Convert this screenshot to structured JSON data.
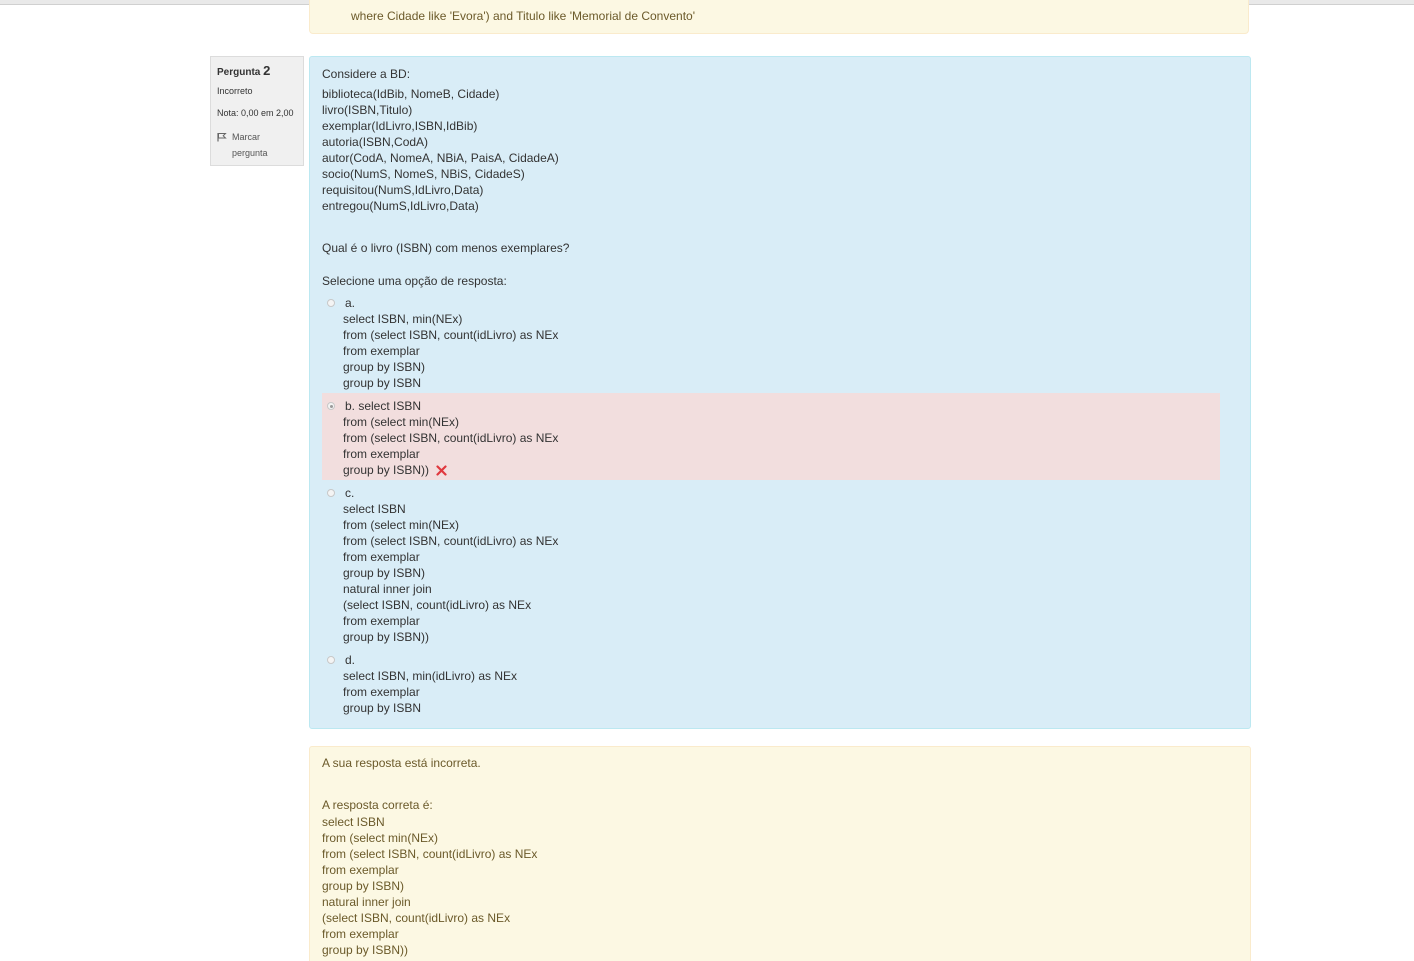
{
  "previous_question": {
    "feedback_line": "where Cidade like 'Evora') and Titulo like 'Memorial de Convento'"
  },
  "question_info": {
    "label": "Pergunta",
    "number": "2",
    "state": "Incorreto",
    "grade": "Nota: 0,00 em 2,00",
    "flag_label_1": "Marcar",
    "flag_label_2": "pergunta"
  },
  "question": {
    "intro": "Considere a BD:",
    "schema": [
      "biblioteca(IdBib, NomeB, Cidade)",
      "livro(ISBN,Titulo)",
      "exemplar(IdLivro,ISBN,IdBib)",
      "autoria(ISBN,CodA)",
      "autor(CodA, NomeA, NBiA, PaisA, CidadeA)",
      "socio(NumS, NomeS, NBiS, CidadeS)",
      "requisitou(NumS,IdLivro,Data)",
      "entregou(NumS,IdLivro,Data)"
    ],
    "text": "Qual é o livro (ISBN) com menos exemplares?",
    "prompt": "Selecione uma opção de resposta:"
  },
  "options": {
    "a": {
      "lines": [
        "a.",
        "select ISBN, min(NEx)",
        "from (select ISBN, count(idLivro) as NEx",
        "from exemplar",
        "group by ISBN)",
        "group by ISBN"
      ],
      "selected": false
    },
    "b": {
      "lines": [
        "b. select ISBN",
        "from (select min(NEx)",
        "from (select ISBN, count(idLivro) as NEx",
        "from exemplar",
        "group by ISBN))"
      ],
      "selected": true,
      "status": "incorrect"
    },
    "c": {
      "lines": [
        "c.",
        "select ISBN",
        "from (select min(NEx)",
        "from (select ISBN, count(idLivro) as NEx",
        "from exemplar",
        "group by ISBN)",
        "natural inner join",
        "(select ISBN, count(idLivro) as NEx",
        "from exemplar",
        "group by ISBN))"
      ],
      "selected": false
    },
    "d": {
      "lines": [
        "d.",
        "select ISBN, min(idLivro) as NEx",
        "from exemplar",
        "group by ISBN"
      ],
      "selected": false
    }
  },
  "outcome": {
    "feedback": "A sua resposta está incorreta.",
    "right_answer_title": "A resposta correta é:",
    "right_answer_lines": [
      "select ISBN",
      "from (select min(NEx)",
      "from (select ISBN, count(idLivro) as NEx",
      "from exemplar",
      "group by ISBN)",
      "natural inner join",
      "(select ISBN, count(idLivro) as NEx",
      "from exemplar",
      "group by ISBN))"
    ]
  },
  "colors": {
    "formulation_bg": "#d9edf7",
    "incorrect_bg": "#f2dede",
    "outcome_bg": "#fcf8e3",
    "info_bg": "#f0f0f0",
    "incorrect_icon": "#e0383e"
  }
}
